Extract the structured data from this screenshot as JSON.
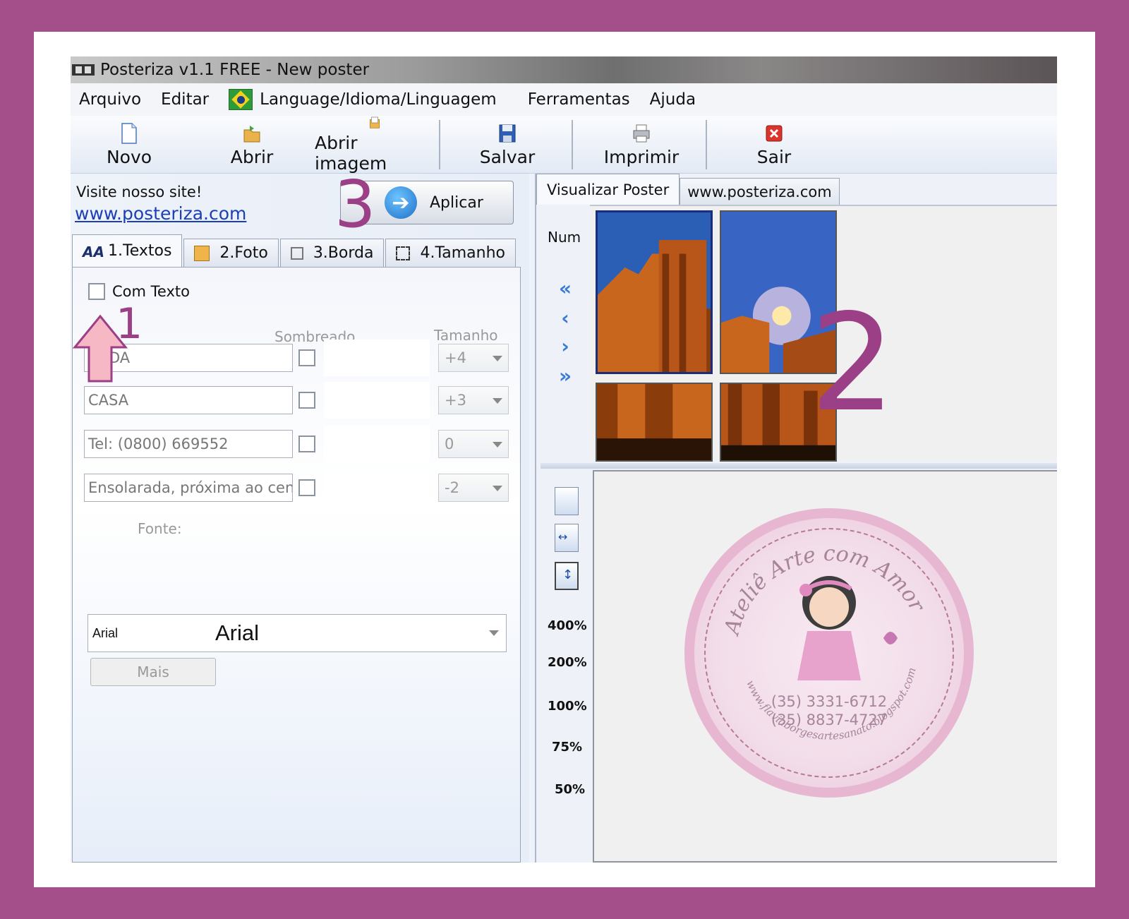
{
  "window": {
    "title": "Posteriza v1.1 FREE - New poster"
  },
  "menu": {
    "items": [
      "Arquivo",
      "Editar",
      "Language/Idioma/Linguagem",
      "Ferramentas",
      "Ajuda"
    ]
  },
  "toolbar": {
    "novo": "Novo",
    "abrir": "Abrir",
    "abrir_imagem": "Abrir imagem",
    "salvar": "Salvar",
    "imprimir": "Imprimir",
    "sair": "Sair"
  },
  "left_panel": {
    "visit_text": "Visite nosso site!",
    "visit_link": "www.posteriza.com",
    "apply_label": "Aplicar",
    "tabs": [
      "1.Textos",
      "2.Foto",
      "3.Borda",
      "4.Tamanho"
    ],
    "com_texto": "Com Texto",
    "col_sombreado": "Sombreado",
    "col_tamanho": "Tamanho",
    "rows": [
      {
        "text": "ENDA",
        "size": "+4"
      },
      {
        "text": "CASA",
        "size": "+3"
      },
      {
        "text": "Tel: (0800) 669552",
        "size": "0"
      },
      {
        "text": "Ensolarada, próxima ao centr",
        "size": "-2"
      }
    ],
    "font_label": "Fonte:",
    "font_small": "Arial",
    "font_big": "Arial",
    "mais_label": "Mais"
  },
  "right_panel": {
    "tabs": [
      "Visualizar Poster",
      "www.posteriza.com"
    ],
    "num_label": "Num",
    "zoom_levels": [
      "400%",
      "200%",
      "100%",
      "75%",
      "50%"
    ]
  },
  "stamp": {
    "title": "Ateliê Arte com Amor",
    "phone1": "(35) 3331-6712",
    "phone2": "(35) 8837-4727",
    "url": "www.flaviaborgesartesanato.blogspot.com"
  },
  "annotations": {
    "one": "1",
    "two": "2",
    "three": "3"
  },
  "colors": {
    "frame": "#a44f8a",
    "annotation": "#9b3f86",
    "link": "#1a3fb8"
  }
}
